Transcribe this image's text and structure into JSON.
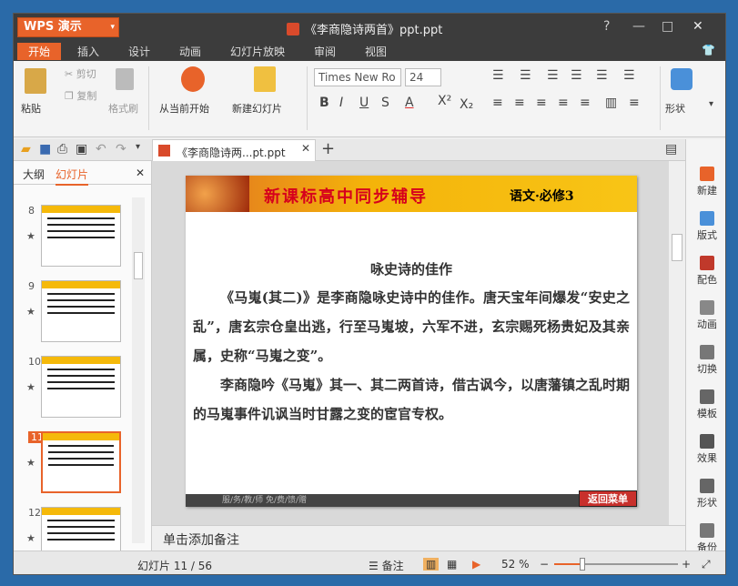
{
  "app": {
    "button_label": "WPS 演示"
  },
  "window": {
    "title": "《李商隐诗两首》ppt.ppt"
  },
  "menu": [
    "开始",
    "插入",
    "设计",
    "动画",
    "幻灯片放映",
    "审阅",
    "视图"
  ],
  "ribbon": {
    "paste": "粘贴",
    "cut": "剪切",
    "copy": "复制",
    "format_painter": "格式刷",
    "from_current": "从当前开始",
    "new_slide": "新建幻灯片",
    "font_name": "Times New Ro",
    "font_size": "24",
    "shape": "形状"
  },
  "doc_tab": "《李商隐诗两...pt.ppt",
  "left_panel": {
    "tabs": [
      "大纲",
      "幻灯片"
    ],
    "thumbs": [
      {
        "num": "8"
      },
      {
        "num": "9"
      },
      {
        "num": "10"
      },
      {
        "num": "11",
        "selected": true
      },
      {
        "num": "12"
      }
    ]
  },
  "slide": {
    "header_title": "新课标高中同步辅导",
    "header_sub": "语文·必修3",
    "heading": "咏史诗的佳作",
    "para1": "《马嵬(其二)》是李商隐咏史诗中的佳作。唐天宝年间爆发“安史之乱”，唐玄宗仓皇出逃，行至马嵬坡，六军不进，玄宗赐死杨贵妃及其亲属，史称“马嵬之变”。",
    "para2": "李商隐吟《马嵬》其一、其二两首诗，借古讽今，以唐藩镇之乱时期的马嵬事件讥讽当时甘露之变的宦官专权。",
    "footer": "服/务/教/师    免/费/馈/赠",
    "back_button": "返回菜单"
  },
  "notes_placeholder": "单击添加备注",
  "right_panel": [
    "新建",
    "版式",
    "配色",
    "动画",
    "切换",
    "模板",
    "效果",
    "形状",
    "备份"
  ],
  "status": {
    "slide_info": "幻灯片 11 / 56",
    "notes": "备注",
    "zoom": "52 %"
  },
  "colors": {
    "accent": "#e8632a"
  }
}
